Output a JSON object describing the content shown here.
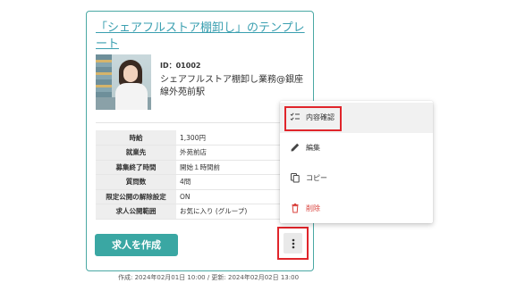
{
  "card": {
    "title": "「シェアフルストア棚卸し」のテンプレート",
    "id_label": "ID：01002",
    "job_name": "シェアフルストア棚卸し業務@銀座線外苑前駅",
    "table": [
      {
        "label": "時給",
        "value": "1,300円"
      },
      {
        "label": "就業先",
        "value": "外苑前店"
      },
      {
        "label": "募集終了時間",
        "value": "開始１時間前"
      },
      {
        "label": "質問数",
        "value": "4問"
      },
      {
        "label": "限定公開の解除設定",
        "value": "ON"
      },
      {
        "label": "求人公開範囲",
        "value": "お気に入り (グループ)"
      }
    ],
    "create_button": "求人を作成",
    "footer": "作成: 2024年02月01日 10:00 / 更新: 2024年02月02日 13:00"
  },
  "menu": {
    "items": [
      {
        "label": "内容確認",
        "icon": "checklist-icon"
      },
      {
        "label": "編集",
        "icon": "pencil-icon"
      },
      {
        "label": "コピー",
        "icon": "copy-icon"
      },
      {
        "label": "削除",
        "icon": "trash-icon"
      }
    ]
  },
  "colors": {
    "accent": "#3aa7a3",
    "link": "#3a9fb0",
    "highlight": "#e0252b",
    "danger": "#d9423c"
  }
}
